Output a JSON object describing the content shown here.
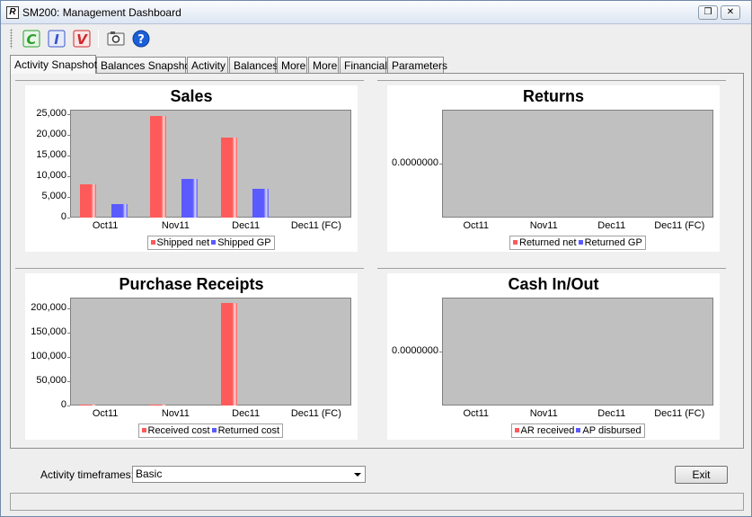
{
  "window": {
    "title": "SM200: Management Dashboard",
    "app_icon_letter": "R",
    "restore_icon": "restore-icon",
    "close_icon": "close-icon"
  },
  "toolbar": {
    "buttons": [
      {
        "name": "customer-button",
        "icon": "green-c-icon",
        "letter": "C",
        "color": "#2aa02a"
      },
      {
        "name": "inventory-button",
        "icon": "blue-i-icon",
        "letter": "I",
        "color": "#3a55c8"
      },
      {
        "name": "vendor-button",
        "icon": "red-v-icon",
        "letter": "V",
        "color": "#d02a2a"
      },
      {
        "name": "snapshot-button",
        "icon": "camera-icon"
      },
      {
        "name": "help-button",
        "icon": "help-icon",
        "letter": "?",
        "color": "#1b5fd6"
      }
    ]
  },
  "tabs": [
    {
      "label": "Activity Snapshot",
      "active": true
    },
    {
      "label": "Balances Snapshot",
      "active": false
    },
    {
      "label": "Activity",
      "active": false
    },
    {
      "label": "Balances",
      "active": false
    },
    {
      "label": "More",
      "active": false
    },
    {
      "label": "More",
      "active": false
    },
    {
      "label": "Financial",
      "active": false
    },
    {
      "label": "Parameters",
      "active": false
    }
  ],
  "colors": {
    "series_red": "#ff5a5a",
    "series_blue": "#5a5aff",
    "plot_bg": "#c0c0c0"
  },
  "chart_data": [
    {
      "type": "bar",
      "title": "Sales",
      "categories": [
        "Oct11",
        "Nov11",
        "Dec11",
        "Dec11 (FC)"
      ],
      "series": [
        {
          "name": "Shipped net",
          "values": [
            8000,
            24500,
            19200,
            0
          ]
        },
        {
          "name": "Shipped GP",
          "values": [
            3300,
            9300,
            7000,
            0
          ]
        }
      ],
      "yticks": [
        "0",
        "5,000",
        "10,000",
        "15,000",
        "20,000",
        "25,000"
      ],
      "ylim": [
        0,
        26000
      ],
      "grid": false,
      "legend": "bottom"
    },
    {
      "type": "bar",
      "title": "Returns",
      "categories": [
        "Oct11",
        "Nov11",
        "Dec11",
        "Dec11 (FC)"
      ],
      "series": [
        {
          "name": "Returned net",
          "values": [
            0,
            0,
            0,
            0
          ]
        },
        {
          "name": "Returned GP",
          "values": [
            0,
            0,
            0,
            0
          ]
        }
      ],
      "yticks": [
        "0.0000000"
      ],
      "ylim": [
        -1,
        1
      ],
      "grid": false,
      "legend": "bottom"
    },
    {
      "type": "bar",
      "title": "Purchase Receipts",
      "categories": [
        "Oct11",
        "Nov11",
        "Dec11",
        "Dec11 (FC)"
      ],
      "series": [
        {
          "name": "Received cost",
          "values": [
            1200,
            1800,
            210000,
            0
          ]
        },
        {
          "name": "Returned cost",
          "values": [
            0,
            0,
            0,
            0
          ]
        }
      ],
      "yticks": [
        "0",
        "50,000",
        "100,000",
        "150,000",
        "200,000"
      ],
      "ylim": [
        0,
        222000
      ],
      "grid": false,
      "legend": "bottom"
    },
    {
      "type": "bar",
      "title": "Cash In/Out",
      "categories": [
        "Oct11",
        "Nov11",
        "Dec11",
        "Dec11 (FC)"
      ],
      "series": [
        {
          "name": "AR received",
          "values": [
            0,
            0,
            0,
            0
          ]
        },
        {
          "name": "AP disbursed",
          "values": [
            0,
            0,
            0,
            0
          ]
        }
      ],
      "yticks": [
        "0.0000000"
      ],
      "ylim": [
        -1,
        1
      ],
      "grid": false,
      "legend": "bottom"
    }
  ],
  "bottom": {
    "timeframes_label": "Activity timeframes:",
    "timeframes_value": "Basic",
    "exit_label": "Exit"
  }
}
